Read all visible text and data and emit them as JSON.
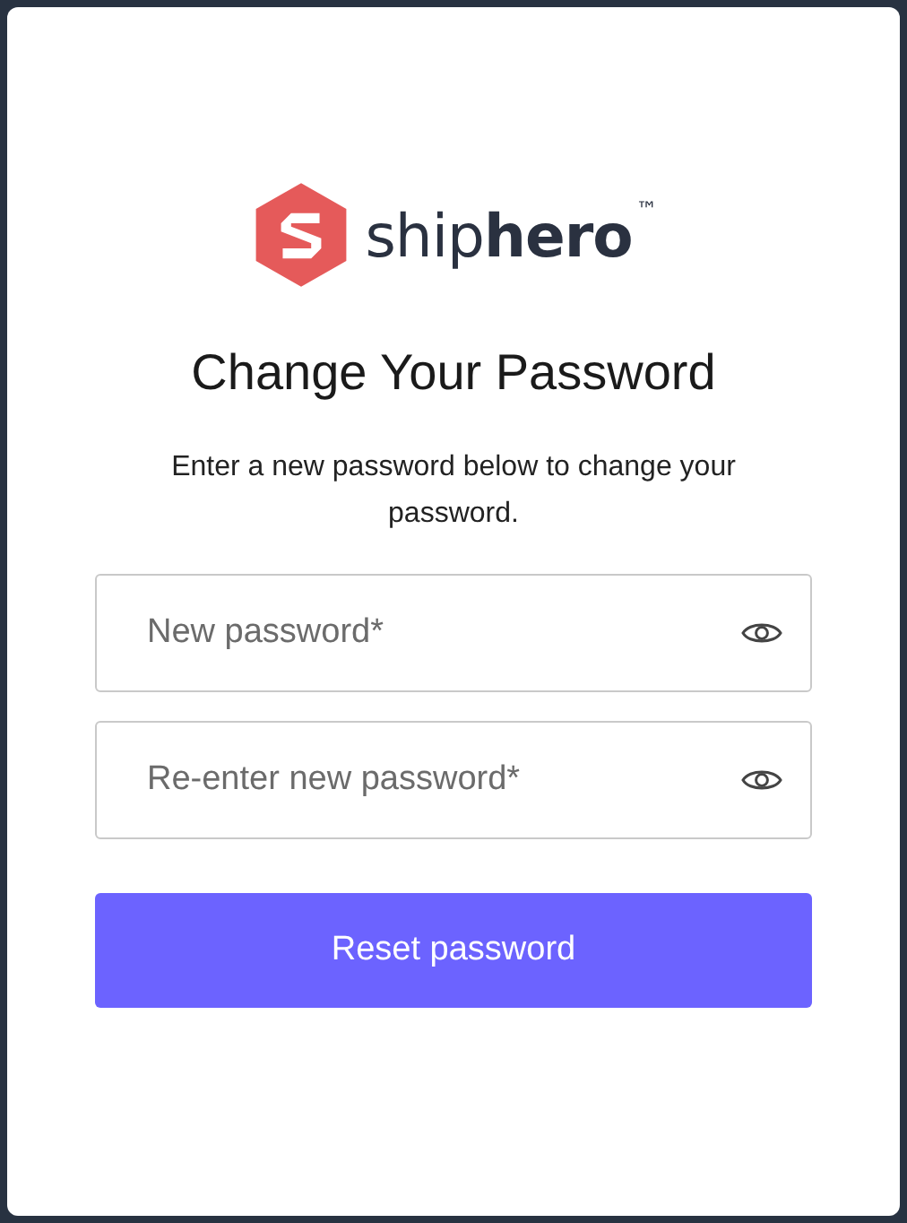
{
  "logo": {
    "wordmark": "ship**hero**$^{™}$"
  },
  "title": "Change Your Password",
  "subtitle": "Enter a new password below to change your password.",
  "fields": [
    {
      "placeholder": "New password*"
    },
    {
      "placeholder": "Re-enter new password*"
    }
  ],
  "submit_button": "Reset password"
}
